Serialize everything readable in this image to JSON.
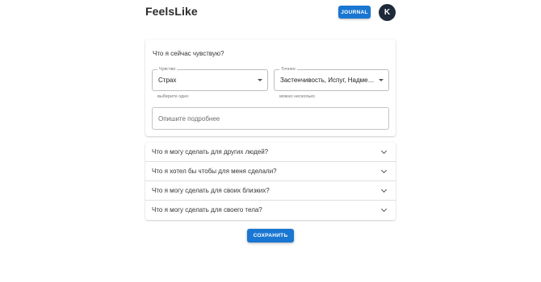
{
  "header": {
    "app_title": "FeelsLike",
    "journal_label": "JOURNAL",
    "avatar_letter": "K"
  },
  "feeling_card": {
    "title": "Что я сейчас чувствую?",
    "feeling_select": {
      "legend": "Чувство",
      "value": "Страх",
      "helper": "выберите одно"
    },
    "nuance_select": {
      "legend": "Точнее",
      "value": "Застенчивость, Испуг, Надме…",
      "helper": "можно несколько"
    },
    "description_placeholder": "Опишите подробнее"
  },
  "accordion": {
    "items": [
      {
        "label": "Что я могу сделать для других людей?"
      },
      {
        "label": "Что я хотел бы чтобы для меня сделали?"
      },
      {
        "label": "Что я могу сделать для своих близких?"
      },
      {
        "label": "Что я могу сделать для своего тела?"
      }
    ]
  },
  "actions": {
    "save_label": "СОХРАНИТЬ"
  },
  "colors": {
    "primary": "#1976d2",
    "avatar_bg": "#1e2a3a"
  }
}
